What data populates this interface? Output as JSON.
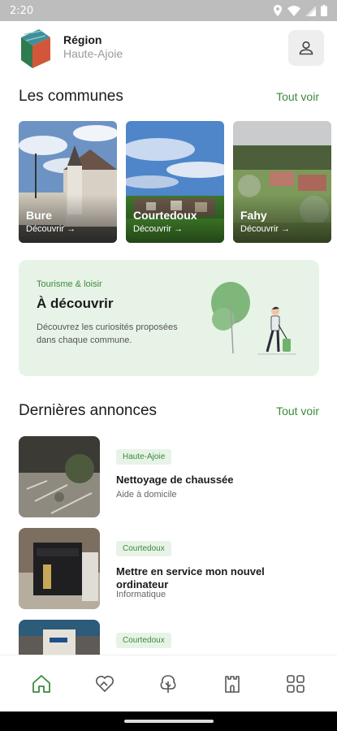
{
  "status_bar": {
    "time": "2:20",
    "icons": [
      "location-icon",
      "wifi-icon",
      "signal-icon",
      "battery-icon"
    ]
  },
  "header": {
    "title": "Région",
    "subtitle": "Haute-Ajoie",
    "profile_icon": "person-icon"
  },
  "communes_section": {
    "title": "Les communes",
    "see_all": "Tout voir",
    "items": [
      {
        "name": "Bure",
        "link": "Découvrir →"
      },
      {
        "name": "Courtedoux",
        "link": "Découvrir →"
      },
      {
        "name": "Fahy",
        "link": "Découvrir →"
      }
    ]
  },
  "discover_card": {
    "tag": "Tourisme & loisir",
    "title": "À découvrir",
    "description": "Découvrez les curiosités proposées dans chaque commune."
  },
  "announcements_section": {
    "title": "Dernières annonces",
    "see_all": "Tout voir",
    "items": [
      {
        "badge": "Haute-Ajoie",
        "title": "Nettoyage de chaussée",
        "category": "Aide à domicile"
      },
      {
        "badge": "Courtedoux",
        "title": "Mettre en service mon nouvel ordinateur",
        "category": "Informatique"
      },
      {
        "badge": "Courtedoux",
        "title": "",
        "category": ""
      }
    ]
  },
  "bottom_nav": {
    "items": [
      {
        "icon": "home-icon",
        "active": true
      },
      {
        "icon": "handshake-heart-icon",
        "active": false
      },
      {
        "icon": "tree-icon",
        "active": false
      },
      {
        "icon": "castle-tower-icon",
        "active": false
      },
      {
        "icon": "grid-icon",
        "active": false
      }
    ]
  },
  "colors": {
    "accent": "#3b8a3b",
    "card_bg": "#e8f3e7",
    "status_bar": "#bdbdbd"
  }
}
